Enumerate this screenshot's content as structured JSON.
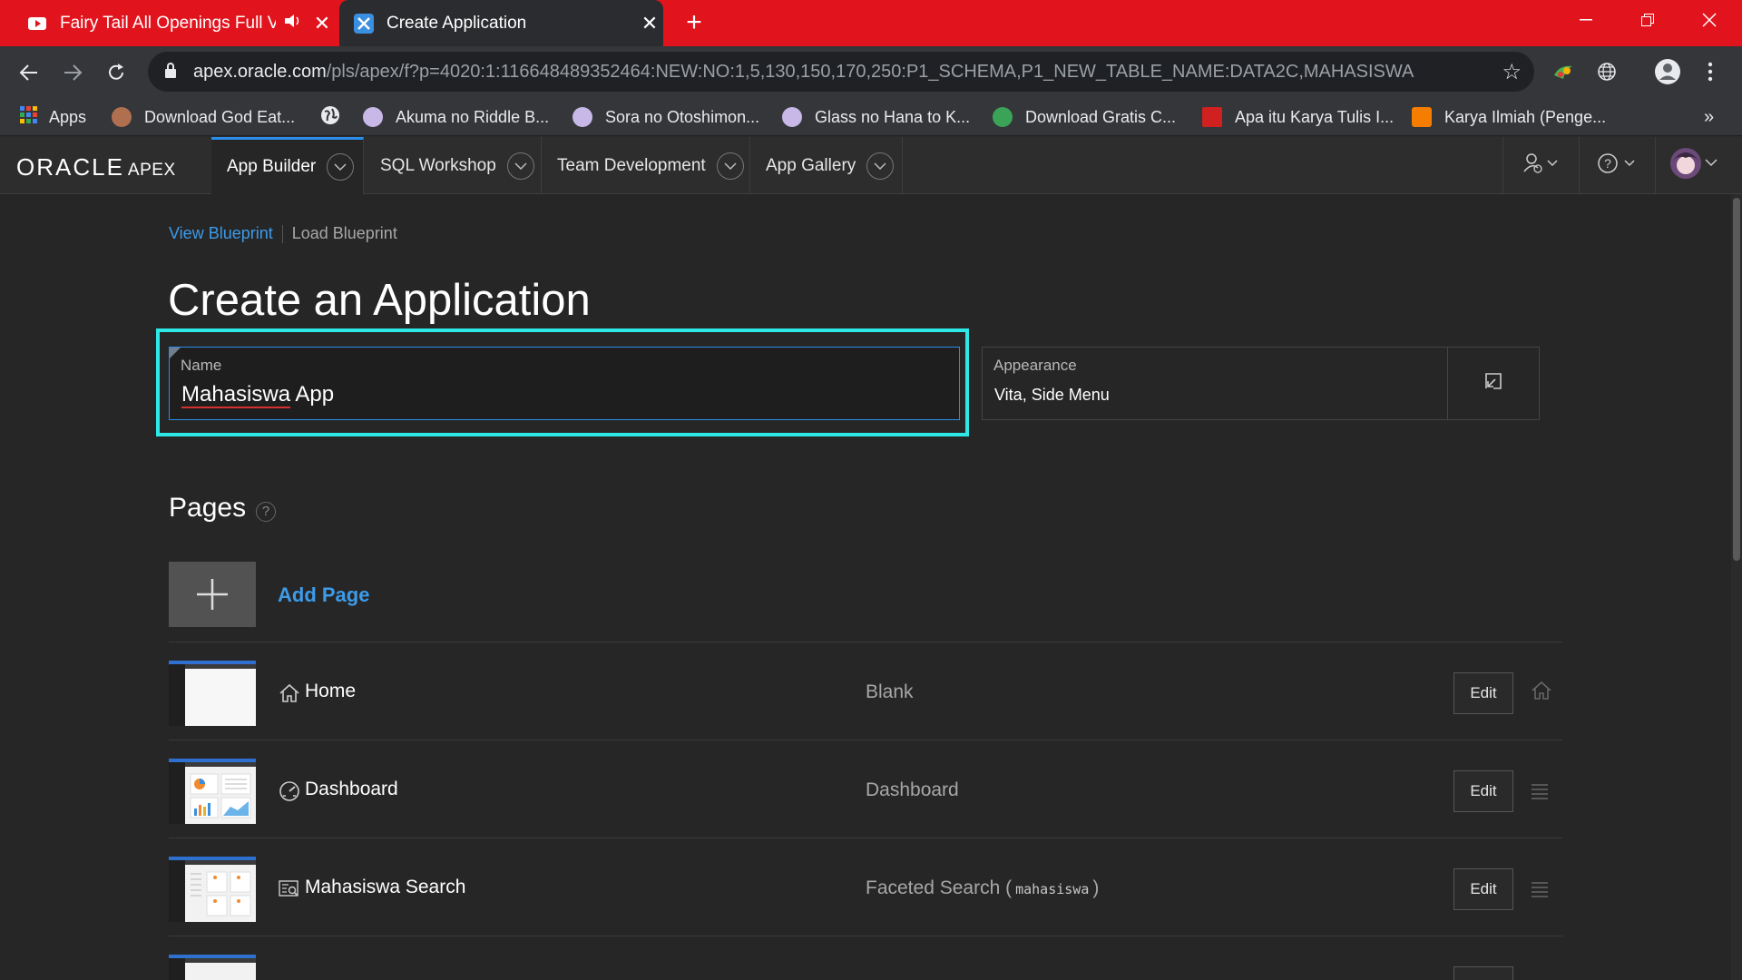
{
  "browser": {
    "tabs": [
      {
        "title": "Fairy Tail All Openings Full Version",
        "icon": "youtube-icon",
        "audio": true
      },
      {
        "title": "Create Application",
        "icon": "apex-icon",
        "active": true
      }
    ],
    "new_tab": "+",
    "url": {
      "host": "apex.oracle.com",
      "path": "/pls/apex/f?p=4020:1:116648489352464:NEW:NO:1,5,130,150,170,250:P1_SCHEMA,P1_NEW_TABLE_NAME:DATA2C,MAHASISWA"
    },
    "bookmarks": [
      {
        "label": "Apps",
        "color": "#4285f4"
      },
      {
        "label": "Download God Eat...",
        "color": "#b07050"
      },
      {
        "label": "",
        "color": "#e8eaed"
      },
      {
        "label": "Akuma no Riddle B...",
        "color": "#c8b8e8"
      },
      {
        "label": "Sora no Otoshimon...",
        "color": "#c8b8e8"
      },
      {
        "label": "Glass no Hana to K...",
        "color": "#c8b8e8"
      },
      {
        "label": "Download Gratis C...",
        "color": "#3aa357"
      },
      {
        "label": "Apa itu Karya Tulis I...",
        "color": "#d02020"
      },
      {
        "label": "Karya Ilmiah (Penge...",
        "color": "#f57d00"
      }
    ],
    "more_bookmarks": "»"
  },
  "apex": {
    "logo": "ORACLE",
    "logo_suffix": "APEX",
    "nav": [
      "App Builder",
      "SQL Workshop",
      "Team Development",
      "App Gallery"
    ]
  },
  "page": {
    "links": {
      "view": "View Blueprint",
      "load": "Load Blueprint"
    },
    "title": "Create an Application",
    "name_field": {
      "label": "Name",
      "value_word1": "Mahasiswa",
      "value_word2": "App"
    },
    "appearance": {
      "label": "Appearance",
      "value": "Vita, Side Menu"
    },
    "pages_header": "Pages",
    "help": "?",
    "add_page": "Add Page",
    "rows": [
      {
        "name": "Home",
        "type": "Blank",
        "mono": "",
        "edit": "Edit",
        "icon": "home-icon"
      },
      {
        "name": "Dashboard",
        "type": "Dashboard",
        "mono": "",
        "edit": "Edit",
        "icon": "dashboard-icon"
      },
      {
        "name": "Mahasiswa Search",
        "type": "Faceted Search (",
        "mono": "mahasiswa",
        "type_end": ")",
        "edit": "Edit",
        "icon": "search-form-icon"
      },
      {
        "name": "",
        "type": "",
        "mono": "",
        "edit": "",
        "icon": ""
      }
    ]
  },
  "colors": {
    "accent": "#2a8ceb",
    "focus": "#2ee8e8",
    "chrome_red": "#e1141e"
  }
}
